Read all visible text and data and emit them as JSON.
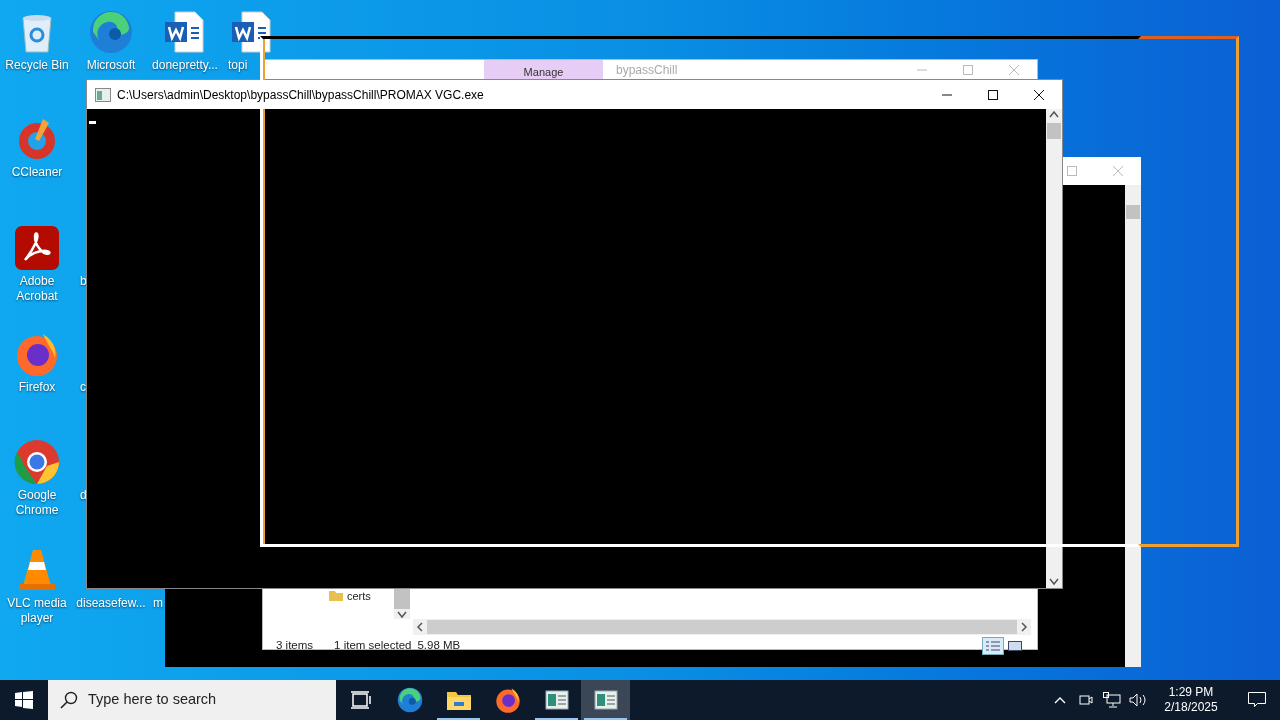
{
  "desktop_icons": [
    {
      "label": "Recycle Bin",
      "kind": "recycle"
    },
    {
      "label": "Microsoft",
      "kind": "edge"
    },
    {
      "label": "donepretty...",
      "kind": "word"
    },
    {
      "label": "topi",
      "kind": "word"
    },
    {
      "label": "CCleaner",
      "kind": "ccleaner"
    },
    {
      "label": "Adobe Acrobat",
      "kind": "acrobat"
    },
    {
      "label": "b",
      "kind": "hidden"
    },
    {
      "label": "Firefox",
      "kind": "firefox"
    },
    {
      "label": "c",
      "kind": "hidden"
    },
    {
      "label": "Google Chrome",
      "kind": "chrome"
    },
    {
      "label": "d",
      "kind": "hidden"
    },
    {
      "label": "VLC media player",
      "kind": "vlc"
    },
    {
      "label": "diseasefew...",
      "kind": "hidden"
    },
    {
      "label": "m",
      "kind": "hidden"
    }
  ],
  "explorer": {
    "title": "bypassChill",
    "ribbon_tab": "Manage",
    "folder": "certs",
    "status": [
      "3 items",
      "1 item selected",
      "5.98 MB"
    ]
  },
  "console": {
    "title": "C:\\Users\\admin\\Desktop\\bypassChill\\bypassChill\\PROMAX VGC.exe"
  },
  "taskbar": {
    "search_placeholder": "Type here to search",
    "apps": [
      {
        "kind": "taskview",
        "running": false,
        "selected": false
      },
      {
        "kind": "edge",
        "running": false,
        "selected": false
      },
      {
        "kind": "folder",
        "running": true,
        "selected": false
      },
      {
        "kind": "firefox",
        "running": false,
        "selected": false
      },
      {
        "kind": "console",
        "running": true,
        "selected": false
      },
      {
        "kind": "console",
        "running": true,
        "selected": true
      }
    ],
    "time": "1:29 PM",
    "date": "2/18/2025"
  }
}
